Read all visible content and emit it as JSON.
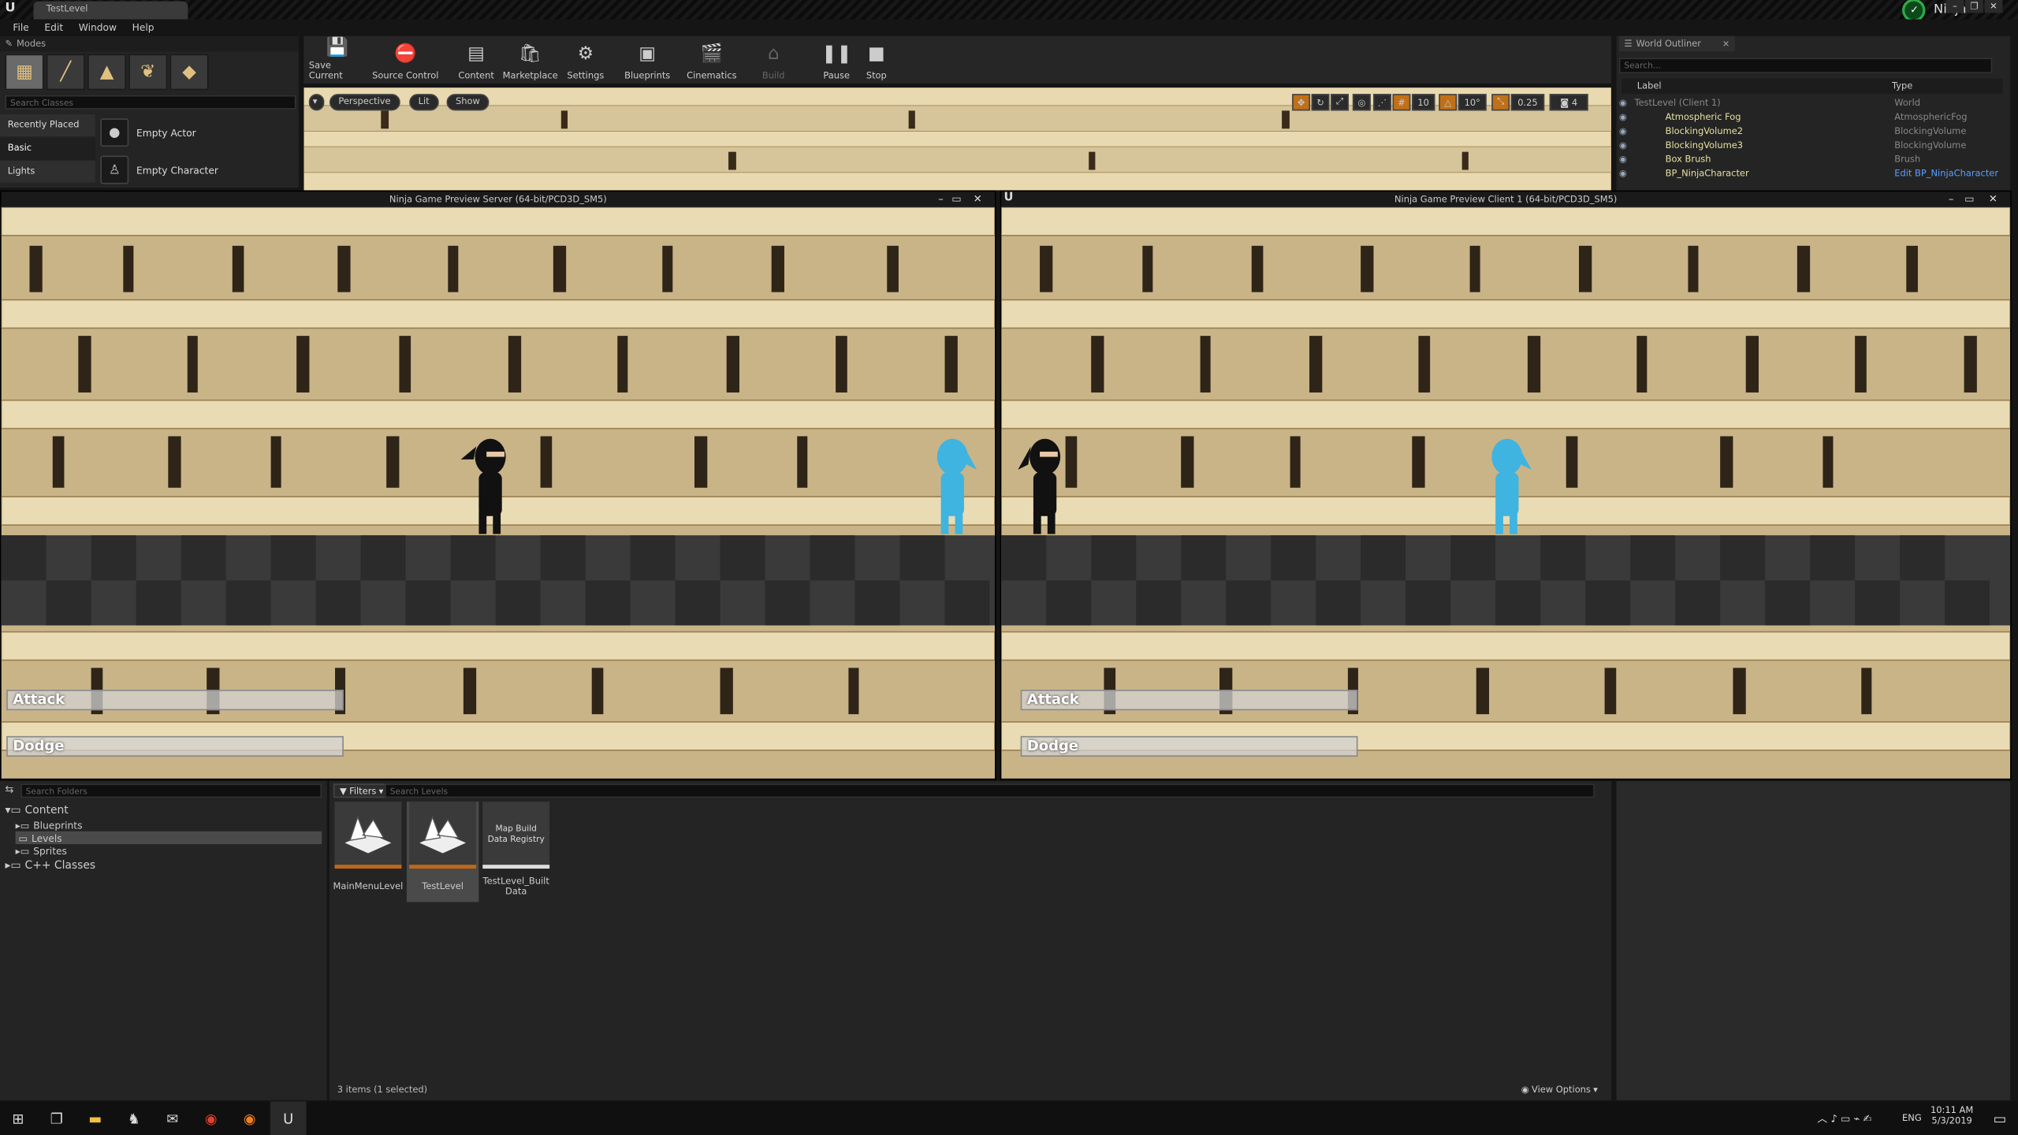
{
  "window": {
    "doc_tab": "TestLevel",
    "project_name": "Ninja"
  },
  "menu": [
    "File",
    "Edit",
    "Window",
    "Help"
  ],
  "modes": {
    "tab_label": "Modes",
    "search_placeholder": "Search Classes",
    "categories": [
      "Recently Placed",
      "Basic",
      "Lights"
    ],
    "placed_items": [
      "Empty Actor",
      "Empty Character"
    ]
  },
  "toolbar": {
    "buttons": [
      "Save Current",
      "Source Control",
      "Content",
      "Marketplace",
      "Settings",
      "Blueprints",
      "Cinematics",
      "Build",
      "Pause",
      "Stop"
    ]
  },
  "viewport": {
    "perspective_label": "Perspective",
    "lit_label": "Lit",
    "show_label": "Show",
    "grid_snap": "10",
    "rot_snap": "10°",
    "scale_snap": "0.25",
    "camera_speed": "4"
  },
  "outliner": {
    "tab_label": "World Outliner",
    "search_placeholder": "Search...",
    "col_label": "Label",
    "col_type": "Type",
    "rows": [
      {
        "label": "TestLevel (Client 1)",
        "type": "World"
      },
      {
        "label": "Atmospheric Fog",
        "type": "AtmosphericFog"
      },
      {
        "label": "BlockingVolume2",
        "type": "BlockingVolume"
      },
      {
        "label": "BlockingVolume3",
        "type": "BlockingVolume"
      },
      {
        "label": "Box Brush",
        "type": "Brush"
      },
      {
        "label": "BP_NinjaCharacter",
        "type": "Edit BP_NinjaCharacter"
      }
    ]
  },
  "game_windows": {
    "server_title": "Ninja Game Preview Server (64-bit/PCD3D_SM5)",
    "client_title": "Ninja Game Preview Client 1 (64-bit/PCD3D_SM5)",
    "hud_attack": "Attack",
    "hud_dodge": "Dodge"
  },
  "content_browser": {
    "folder_search_placeholder": "Search Folders",
    "filters_label": "Filters",
    "levels_search_placeholder": "Search Levels",
    "tree": [
      "Content",
      "Blueprints",
      "Levels",
      "Sprites",
      "C++ Classes"
    ],
    "assets": [
      {
        "name": "MainMenuLevel"
      },
      {
        "name": "TestLevel"
      },
      {
        "name": "TestLevel_BuiltData",
        "thumb_text": "Map Build Data Registry"
      }
    ],
    "status": "3 items (1 selected)",
    "view_options": "View Options"
  },
  "taskbar": {
    "language": "ENG",
    "time": "10:11 AM",
    "date": "5/3/2019"
  }
}
